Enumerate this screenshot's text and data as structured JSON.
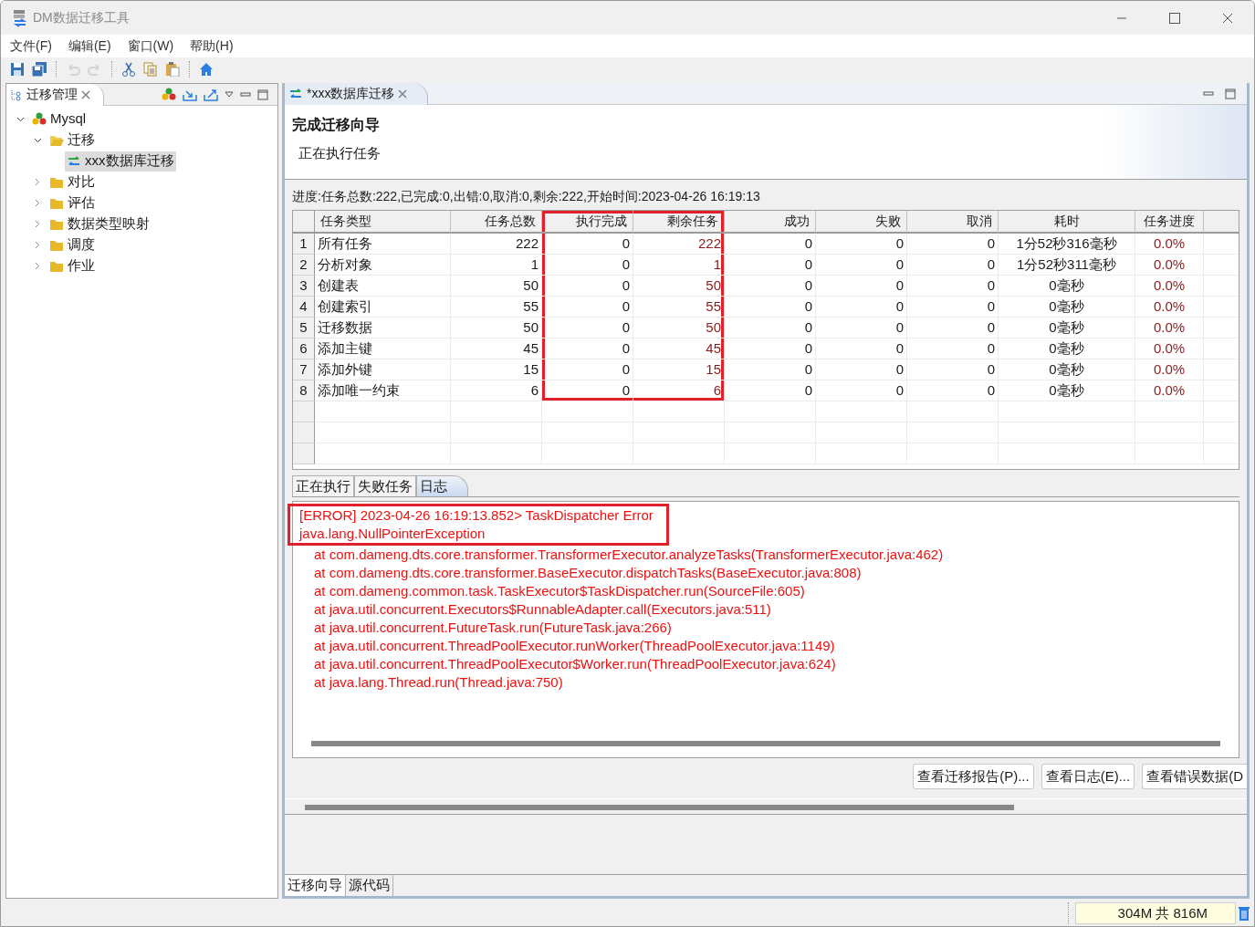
{
  "window": {
    "title": "DM数据迁移工具"
  },
  "menu": [
    {
      "label": "文件(F)"
    },
    {
      "label": "编辑(E)"
    },
    {
      "label": "窗口(W)"
    },
    {
      "label": "帮助(H)"
    }
  ],
  "toolbar": [
    {
      "kind": "save",
      "disabled": false
    },
    {
      "kind": "save-all",
      "disabled": false
    },
    {
      "kind": "sep"
    },
    {
      "kind": "undo",
      "disabled": true
    },
    {
      "kind": "redo",
      "disabled": true
    },
    {
      "kind": "sep"
    },
    {
      "kind": "cut",
      "disabled": false
    },
    {
      "kind": "copy",
      "disabled": false
    },
    {
      "kind": "paste",
      "disabled": false
    },
    {
      "kind": "sep"
    },
    {
      "kind": "home",
      "disabled": false
    }
  ],
  "navigator": {
    "tab": "迁移管理",
    "tree": [
      {
        "label": "Mysql",
        "kind": "database",
        "expanded": true,
        "selected": false,
        "children": [
          {
            "label": "迁移",
            "kind": "folder-open",
            "expanded": true,
            "selected": false,
            "children": [
              {
                "label": "xxx数据库迁移",
                "kind": "migration",
                "selected": true
              }
            ]
          },
          {
            "label": "对比",
            "kind": "folder",
            "expanded": false,
            "selected": false
          },
          {
            "label": "评估",
            "kind": "folder",
            "expanded": false,
            "selected": false
          },
          {
            "label": "数据类型映射",
            "kind": "folder",
            "expanded": false,
            "selected": false
          },
          {
            "label": "调度",
            "kind": "folder",
            "expanded": false,
            "selected": false
          },
          {
            "label": "作业",
            "kind": "folder",
            "expanded": false,
            "selected": false
          }
        ]
      }
    ]
  },
  "editor": {
    "tab": "*xxx数据库迁移",
    "wizard_title": "完成迁移向导",
    "wizard_subtitle": "正在执行任务",
    "progress": "进度:任务总数:222,已完成:0,出错:0,取消:0,剩余:222,开始时间:2023-04-26 16:19:13",
    "table": {
      "columns": [
        {
          "label": "任务类型",
          "kind": "text",
          "emphasis": false,
          "highlighted": false
        },
        {
          "label": "任务总数",
          "kind": "number",
          "emphasis": false,
          "highlighted": false
        },
        {
          "label": "执行完成",
          "kind": "number",
          "emphasis": false,
          "highlighted": true
        },
        {
          "label": "剩余任务",
          "kind": "number",
          "emphasis": true,
          "highlighted": true
        },
        {
          "label": "成功",
          "kind": "number",
          "emphasis": false,
          "highlighted": false
        },
        {
          "label": "失败",
          "kind": "number",
          "emphasis": false,
          "highlighted": false
        },
        {
          "label": "取消",
          "kind": "number",
          "emphasis": false,
          "highlighted": false
        },
        {
          "label": "耗时",
          "kind": "duration",
          "emphasis": false,
          "highlighted": false
        },
        {
          "label": "任务进度",
          "kind": "percent",
          "emphasis": true,
          "highlighted": false
        }
      ],
      "rows": [
        {
          "number": "1",
          "cells": [
            "所有任务",
            "222",
            "0",
            "222",
            "0",
            "0",
            "0",
            "1分52秒316毫秒",
            "0.0%"
          ]
        },
        {
          "number": "2",
          "cells": [
            "分析对象",
            "1",
            "0",
            "1",
            "0",
            "0",
            "0",
            "1分52秒311毫秒",
            "0.0%"
          ]
        },
        {
          "number": "3",
          "cells": [
            "创建表",
            "50",
            "0",
            "50",
            "0",
            "0",
            "0",
            "0毫秒",
            "0.0%"
          ]
        },
        {
          "number": "4",
          "cells": [
            "创建索引",
            "55",
            "0",
            "55",
            "0",
            "0",
            "0",
            "0毫秒",
            "0.0%"
          ]
        },
        {
          "number": "5",
          "cells": [
            "迁移数据",
            "50",
            "0",
            "50",
            "0",
            "0",
            "0",
            "0毫秒",
            "0.0%"
          ]
        },
        {
          "number": "6",
          "cells": [
            "添加主键",
            "45",
            "0",
            "45",
            "0",
            "0",
            "0",
            "0毫秒",
            "0.0%"
          ]
        },
        {
          "number": "7",
          "cells": [
            "添加外键",
            "15",
            "0",
            "15",
            "0",
            "0",
            "0",
            "0毫秒",
            "0.0%"
          ]
        },
        {
          "number": "8",
          "cells": [
            "添加唯一约束",
            "6",
            "0",
            "6",
            "0",
            "0",
            "0",
            "0毫秒",
            "0.0%"
          ]
        }
      ]
    },
    "detail_tabs": [
      {
        "label": "正在执行",
        "selected": false
      },
      {
        "label": "失败任务",
        "selected": false
      },
      {
        "label": "日志",
        "selected": true
      }
    ],
    "log": [
      {
        "kind": "message",
        "highlighted": true,
        "text": "[ERROR] 2023-04-26 16:19:13.852> TaskDispatcher Error"
      },
      {
        "kind": "message",
        "highlighted": true,
        "text": "java.lang.NullPointerException"
      },
      {
        "kind": "trace",
        "highlighted": false,
        "text": "at com.dameng.dts.core.transformer.TransformerExecutor.analyzeTasks(TransformerExecutor.java:462)"
      },
      {
        "kind": "trace",
        "highlighted": false,
        "text": "at com.dameng.dts.core.transformer.BaseExecutor.dispatchTasks(BaseExecutor.java:808)"
      },
      {
        "kind": "trace",
        "highlighted": false,
        "text": "at com.dameng.common.task.TaskExecutor$TaskDispatcher.run(SourceFile:605)"
      },
      {
        "kind": "trace",
        "highlighted": false,
        "text": "at java.util.concurrent.Executors$RunnableAdapter.call(Executors.java:511)"
      },
      {
        "kind": "trace",
        "highlighted": false,
        "text": "at java.util.concurrent.FutureTask.run(FutureTask.java:266)"
      },
      {
        "kind": "trace",
        "highlighted": false,
        "text": "at java.util.concurrent.ThreadPoolExecutor.runWorker(ThreadPoolExecutor.java:1149)"
      },
      {
        "kind": "trace",
        "highlighted": false,
        "text": "at java.util.concurrent.ThreadPoolExecutor$Worker.run(ThreadPoolExecutor.java:624)"
      },
      {
        "kind": "trace",
        "highlighted": false,
        "text": "at java.lang.Thread.run(Thread.java:750)"
      }
    ],
    "buttons": [
      {
        "label": "查看迁移报告(P)..."
      },
      {
        "label": "查看日志(E)..."
      },
      {
        "label": "查看错误数据(D"
      }
    ],
    "page_tabs": [
      {
        "label": "迁移向导",
        "selected": true
      },
      {
        "label": "源代码",
        "selected": false
      }
    ]
  },
  "status_bar": {
    "memory": "304M 共 816M"
  }
}
